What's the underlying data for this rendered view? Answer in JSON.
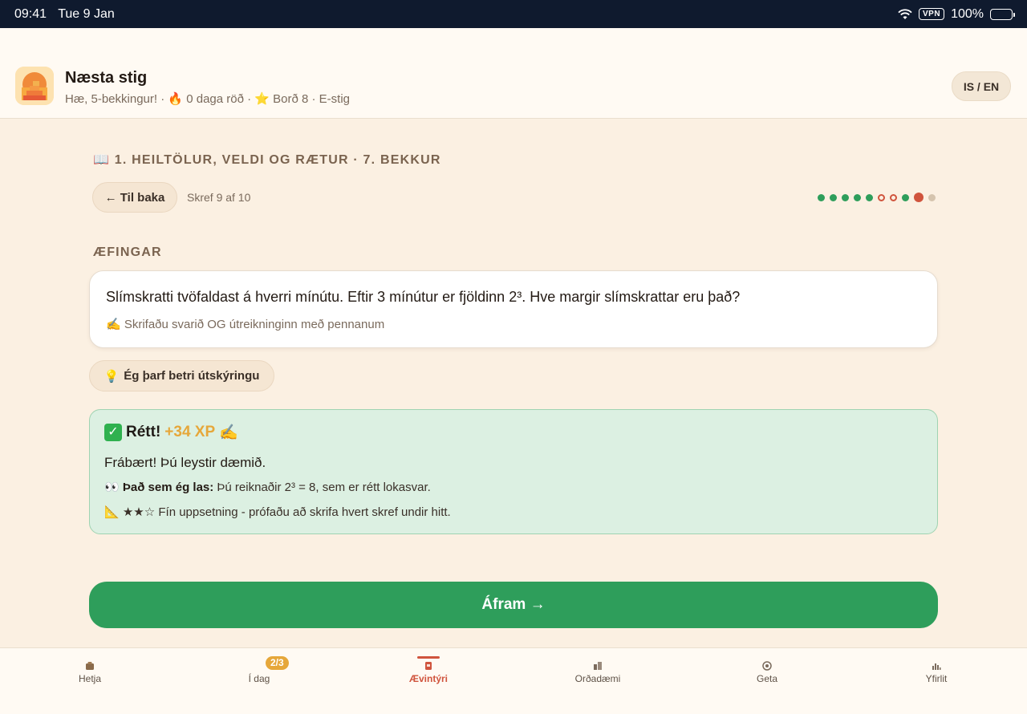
{
  "status_bar": {
    "time": "09:41",
    "date": "Tue 9 Jan",
    "vpn": "VPN",
    "battery": "100%"
  },
  "header": {
    "title": "Næsta stig",
    "subtitle": "Hæ, 5-bekkingur! · 🔥 0 daga röð · ⭐ Borð 8 · E-stig",
    "lang_toggle": "IS / EN"
  },
  "lesson": {
    "section_title": "📖 1. HEILTÖLUR, VELDI OG RÆTUR · 7. BEKKUR",
    "back_label": "← Til baka",
    "step_text": "Skref 9 af 10",
    "step_dots": [
      "correct",
      "correct",
      "correct",
      "correct",
      "correct",
      "missed",
      "missed",
      "correct",
      "current",
      "todo"
    ],
    "progress_colors": {
      "correct": "#2e9e5b",
      "missed": "#d0543d",
      "current": "#d0543d",
      "todo": "#d5c4ae"
    }
  },
  "exercise": {
    "label": "ÆFINGAR",
    "question": "Slímskratti tvöfaldast á hverri mínútu. Eftir 3 mínútur er fjöldinn 2³. Hve margir slímskrattar eru það?",
    "hint": "✍️ Skrifaðu svarið OG útreikninginn með pennanum",
    "help_label": "Ég þarf betri útskýringu",
    "help_icon": "💡"
  },
  "feedback": {
    "check": "✓",
    "title": "Rétt!",
    "xp": "+34 XP",
    "xp_icon": "✍️",
    "message": "Frábært! Þú leystir dæmið.",
    "read_icon": "👀",
    "read_label": "Það sem ég las:",
    "read_text": "Þú reiknaðir 2³ = 8, sem er rétt lokasvar.",
    "rating_icon": "📐",
    "rating_stars": "★★☆",
    "rating_text": "Fín uppsetning - prófaðu að skrifa hvert skref undir hitt."
  },
  "continue_label": "Áfram →",
  "nav": {
    "items": [
      {
        "label": "Hetja",
        "icon": "hero-icon"
      },
      {
        "label": "Í dag",
        "icon": "today-icon",
        "badge": "2/3"
      },
      {
        "label": "Ævintýri",
        "icon": "adventure-icon",
        "active": true
      },
      {
        "label": "Orðadæmi",
        "icon": "word-problems-icon"
      },
      {
        "label": "Geta",
        "icon": "ability-icon"
      },
      {
        "label": "Yfirlit",
        "icon": "overview-icon"
      }
    ]
  },
  "colors": {
    "accent_green": "#2e9e5b",
    "accent_red": "#d0543d",
    "xp_gold": "#e6a73a",
    "background": "#fbf0e2"
  }
}
